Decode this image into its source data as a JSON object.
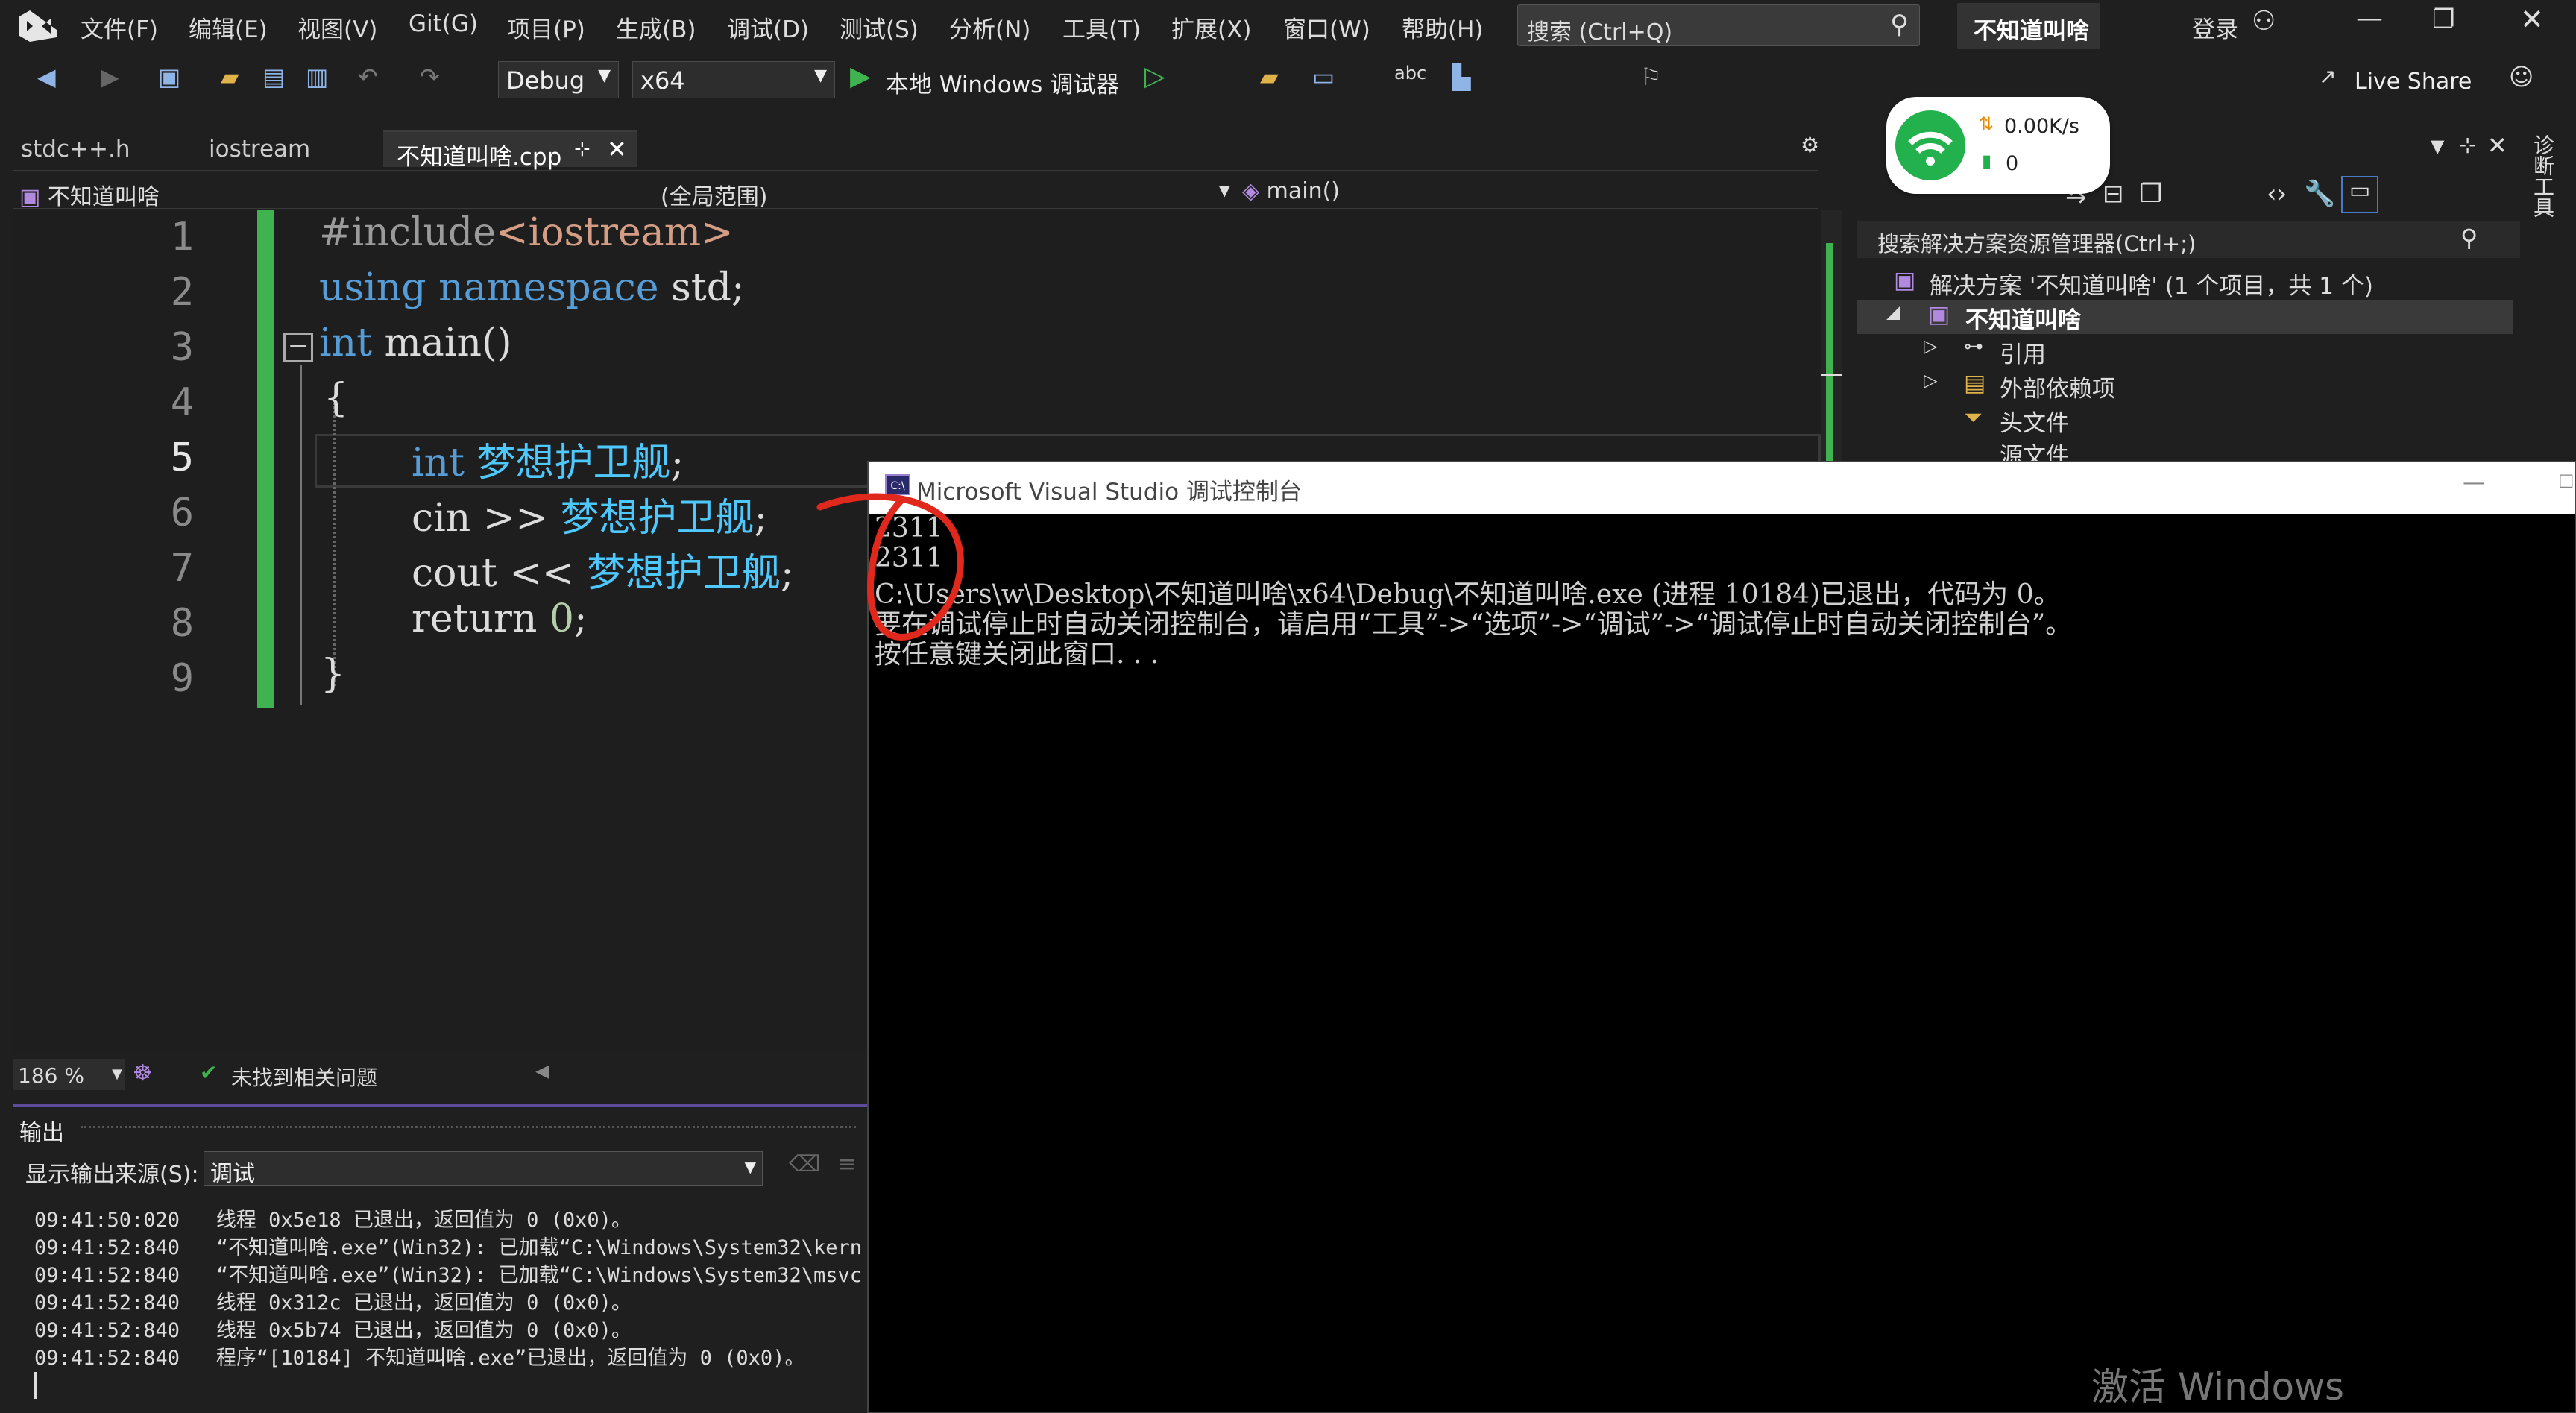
{
  "menubar": {
    "items": [
      "文件(F)",
      "编辑(E)",
      "视图(V)",
      "Git(G)",
      "项目(P)",
      "生成(B)",
      "调试(D)",
      "测试(S)",
      "分析(N)",
      "工具(T)",
      "扩展(X)",
      "窗口(W)",
      "帮助(H)"
    ],
    "search_placeholder": "搜索 (Ctrl+Q)",
    "solution_name": "不知道叫啥",
    "login": "登录"
  },
  "toolbar": {
    "config": "Debug",
    "platform": "x64",
    "run_label": "本地 Windows 调试器",
    "live_share": "Live Share"
  },
  "tabs": [
    "stdc++.h",
    "iostream",
    "不知道叫啥.cpp"
  ],
  "navbar": {
    "project": "不知道叫啥",
    "scope": "(全局范围)",
    "member": "main()"
  },
  "editor": {
    "line_numbers": [
      "1",
      "2",
      "3",
      "4",
      "5",
      "6",
      "7",
      "8",
      "9"
    ],
    "lines": [
      {
        "a": "#include",
        "b": "<iostream>"
      },
      {
        "a": "using",
        "b": "namespace",
        "c": " std;"
      },
      {
        "a": "int",
        "b": " main()"
      },
      {
        "a": "{"
      },
      {
        "a": "int",
        "b": " 梦想护卫舰",
        "c": ";"
      },
      {
        "a": "cin >> ",
        "b": "梦想护卫舰",
        "c": ";"
      },
      {
        "a": "cout << ",
        "b": "梦想护卫舰",
        "c": ";"
      },
      {
        "a": "return ",
        "b": "0",
        "c": ";"
      },
      {
        "a": "}"
      }
    ]
  },
  "status": {
    "zoom": "186 %",
    "issues": "未找到相关问题"
  },
  "output": {
    "title": "输出",
    "source_label": "显示输出来源(S):",
    "source_value": "调试",
    "lines": [
      "09:41:50:020   线程 0x5e18 已退出，返回值为 0 (0x0)。",
      "09:41:52:840   “不知道叫啥.exe”(Win32): 已加载“C:\\Windows\\System32\\kern",
      "09:41:52:840   “不知道叫啥.exe”(Win32): 已加载“C:\\Windows\\System32\\msvc",
      "09:41:52:840   线程 0x312c 已退出，返回值为 0 (0x0)。",
      "09:41:52:840   线程 0x5b74 已退出，返回值为 0 (0x0)。",
      "09:41:52:840   程序“[10184] 不知道叫啥.exe”已退出，返回值为 0 (0x0)。"
    ]
  },
  "solution_explorer": {
    "search": "搜索解决方案资源管理器(Ctrl+;)",
    "solution": "解决方案 '不知道叫啥' (1 个项目，共 1 个)",
    "project": "不知道叫啥",
    "items": [
      "引用",
      "外部依赖项",
      "头文件",
      "源文件"
    ]
  },
  "side_tab": "诊断工具",
  "wifi": {
    "speed": "0.00K/s",
    "count": "0"
  },
  "console": {
    "title": "Microsoft Visual Studio 调试控制台",
    "lines": [
      "2311",
      "2311",
      "C:\\Users\\w\\Desktop\\不知道叫啥\\x64\\Debug\\不知道叫啥.exe (进程 10184)已退出，代码为 0。",
      "要在调试停止时自动关闭控制台，请启用“工具”->“选项”->“调试”->“调试停止时自动关闭控制台”。",
      "按任意键关闭此窗口. . ."
    ]
  },
  "watermark": "激活 Windows",
  "colors": {
    "keyword": "#569cd6",
    "variable": "#4ec9ff",
    "string": "#d69d85",
    "change_bar": "#3fb34f",
    "annotation": "#e0281c"
  }
}
